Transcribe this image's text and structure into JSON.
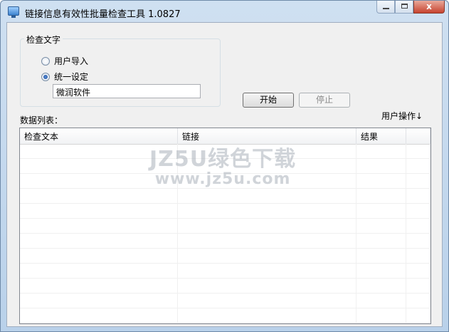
{
  "window": {
    "title": "链接信息有效性批量检查工具 1.0827",
    "minimize_label": "",
    "maximize_label": "",
    "close_label": "x"
  },
  "check_text_group": {
    "label": "检查文字",
    "radio_user_import": "用户导入",
    "radio_unified": "统一设定",
    "selected": "统一设定",
    "input_value": "微润软件"
  },
  "buttons": {
    "start": "开始",
    "stop": "停止"
  },
  "data_list": {
    "label": "数据列表：",
    "user_operation": "用户操作↓",
    "columns": [
      "检查文本",
      "链接",
      "结果",
      ""
    ],
    "row_count": 12
  },
  "watermark": {
    "line1": "JZ5U绿色下载",
    "line2": "www.jz5u.com"
  }
}
